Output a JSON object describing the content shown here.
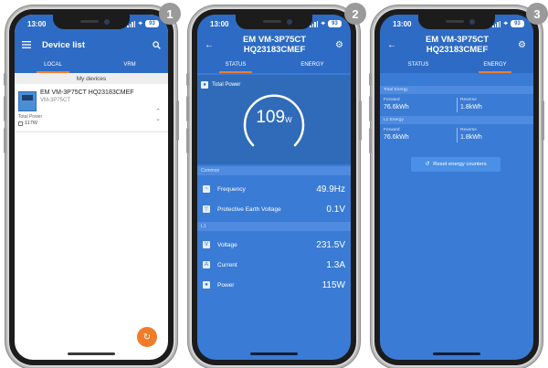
{
  "status_time": "13:00",
  "battery_level": "93",
  "badges": [
    "1",
    "2",
    "3"
  ],
  "colors": {
    "appbar": "#2e6bc4",
    "accent": "#f07c2a",
    "panel": "#3a7bd5",
    "group_header": "#4f8be0"
  },
  "screen1": {
    "title": "Device list",
    "menu_icon": "hamburger-menu-icon",
    "search_icon": "search-icon",
    "tabs": [
      {
        "label": "LOCAL",
        "active": true
      },
      {
        "label": "VRM",
        "active": false
      }
    ],
    "section_title": "My devices",
    "device": {
      "name": "EM VM-3P75CT HQ23183CMEF",
      "model": "VM-3P75CT",
      "total_power_label": "Total Power",
      "total_power_value": "117W"
    },
    "fab_icon": "refresh-icon"
  },
  "screen2": {
    "title": "EM VM-3P75CT HQ23183CMEF",
    "tabs": [
      {
        "label": "STATUS",
        "active": true
      },
      {
        "label": "ENERGY",
        "active": false
      }
    ],
    "total_power_label": "Total Power",
    "gauge_value": "109",
    "gauge_unit": "W",
    "common_header": "Common",
    "common_rows": [
      {
        "label": "Frequency",
        "value": "49.9Hz"
      },
      {
        "label": "Protective Earth Voltage",
        "value": "0.1V"
      }
    ],
    "l1_header": "L1",
    "l1_rows": [
      {
        "label": "Voltage",
        "value": "231.5V"
      },
      {
        "label": "Current",
        "value": "1.3A"
      },
      {
        "label": "Power",
        "value": "115W"
      }
    ]
  },
  "screen3": {
    "title": "EM VM-3P75CT HQ23183CMEF",
    "tabs": [
      {
        "label": "STATUS",
        "active": false
      },
      {
        "label": "ENERGY",
        "active": true
      }
    ],
    "total_energy_header": "Total Energy",
    "total_forward_label": "Forward",
    "total_forward_value": "76.6kWh",
    "total_reverse_label": "Reverse",
    "total_reverse_value": "1.8kWh",
    "l1_energy_header": "L1 Energy",
    "l1_forward_label": "Forward",
    "l1_forward_value": "76.6kWh",
    "l1_reverse_label": "Reverse",
    "l1_reverse_value": "1.8kWh",
    "reset_label": "Reset energy counters"
  }
}
